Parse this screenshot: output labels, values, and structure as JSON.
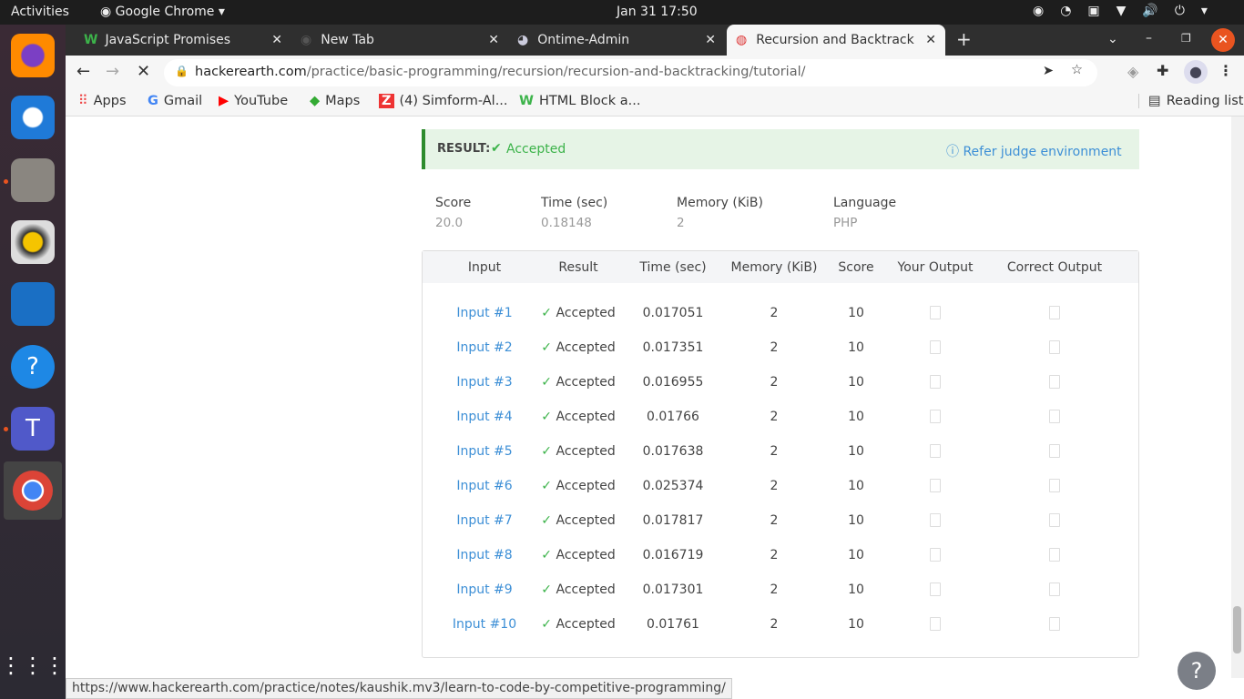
{
  "system": {
    "activities": "Activities",
    "app": "Google Chrome",
    "clock": "Jan 31  17:50"
  },
  "tabs": [
    {
      "label": "JavaScript Promises"
    },
    {
      "label": "New Tab"
    },
    {
      "label": "Ontime-Admin"
    },
    {
      "label": "Recursion and Backtracking"
    }
  ],
  "url": {
    "domain": "hackerearth.com",
    "path": "/practice/basic-programming/recursion/recursion-and-backtracking/tutorial/"
  },
  "bookmarks": [
    "Apps",
    "Gmail",
    "YouTube",
    "Maps",
    "(4) Simform-Al...",
    "HTML Block a..."
  ],
  "reading_list": "Reading list",
  "result": {
    "label": "RESULT:",
    "status": "Accepted",
    "refer": "Refer judge environment"
  },
  "summary": {
    "headers": [
      "Score",
      "Time (sec)",
      "Memory (KiB)",
      "Language"
    ],
    "values": [
      "20.0",
      "0.18148",
      "2",
      "PHP"
    ]
  },
  "table": {
    "headers": [
      "Input",
      "Result",
      "Time (sec)",
      "Memory (KiB)",
      "Score",
      "Your Output",
      "Correct Output"
    ],
    "rows": [
      [
        "Input #1",
        "Accepted",
        "0.017051",
        "2",
        "10"
      ],
      [
        "Input #2",
        "Accepted",
        "0.017351",
        "2",
        "10"
      ],
      [
        "Input #3",
        "Accepted",
        "0.016955",
        "2",
        "10"
      ],
      [
        "Input #4",
        "Accepted",
        "0.01766",
        "2",
        "10"
      ],
      [
        "Input #5",
        "Accepted",
        "0.017638",
        "2",
        "10"
      ],
      [
        "Input #6",
        "Accepted",
        "0.025374",
        "2",
        "10"
      ],
      [
        "Input #7",
        "Accepted",
        "0.017817",
        "2",
        "10"
      ],
      [
        "Input #8",
        "Accepted",
        "0.016719",
        "2",
        "10"
      ],
      [
        "Input #9",
        "Accepted",
        "0.017301",
        "2",
        "10"
      ],
      [
        "Input #10",
        "Accepted",
        "0.01761",
        "2",
        "10"
      ]
    ]
  },
  "status_url": "https://www.hackerearth.com/practice/notes/kaushik.mv3/learn-to-code-by-competitive-programming/",
  "colors": {
    "accepted": "#3cb34a",
    "link": "#3d8fd6",
    "result_bg": "#e6f4e6"
  }
}
